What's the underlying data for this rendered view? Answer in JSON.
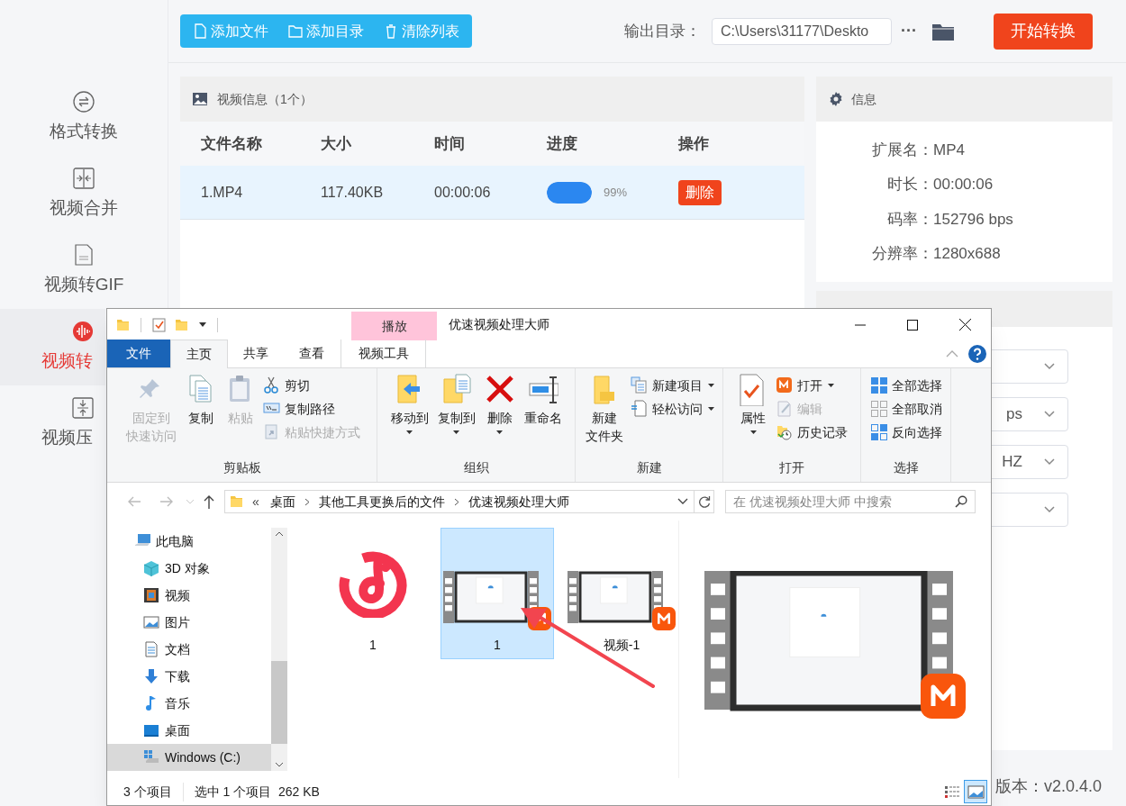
{
  "app": {
    "toolbar_buttons": [
      {
        "label": "添加文件",
        "kind": "file"
      },
      {
        "label": "添加目录",
        "kind": "folder"
      },
      {
        "label": "清除列表",
        "kind": "trash"
      }
    ],
    "output_dir": {
      "label": "输出目录：",
      "value": "C:\\Users\\31177\\Deskto",
      "more": "···"
    },
    "start_button": "开始转换",
    "sidebar": [
      {
        "label": "格式转换",
        "kind": "convert",
        "selected": false
      },
      {
        "label": "视频合并",
        "kind": "merge",
        "selected": false
      },
      {
        "label": "视频转GIF",
        "kind": "gif",
        "selected": false
      },
      {
        "label": "视频转",
        "kind": "audio",
        "selected": true
      },
      {
        "label": "视频压",
        "kind": "compress",
        "selected": false
      }
    ],
    "video_panel": {
      "title": "视频信息（1个）",
      "columns": [
        "文件名称",
        "大小",
        "时间",
        "进度",
        "操作"
      ],
      "rows": [
        {
          "name": "1.MP4",
          "size": "117.40KB",
          "time": "00:00:06",
          "level": 0.99,
          "percent": "99%",
          "action": "删除",
          "selected": true
        }
      ]
    },
    "info_panel": {
      "title": "信息",
      "fields": [
        {
          "label": "扩展名：",
          "value": "MP4"
        },
        {
          "label": "时长：",
          "value": "00:00:06"
        },
        {
          "label": "码率：",
          "value": "152796 bps"
        },
        {
          "label": "分辨率：",
          "value": "1280x688"
        }
      ]
    },
    "settings_panel": {
      "dropdowns": [
        {
          "kind": "select"
        },
        {
          "kind": "select",
          "value": "ps"
        },
        {
          "kind": "select",
          "value": "HZ"
        },
        {
          "kind": "select"
        }
      ]
    },
    "version": "版本：v2.0.4.0"
  },
  "explorer": {
    "title": "优速视频处理大师",
    "context_tab": "播放",
    "tabs": [
      {
        "label": "文件",
        "kind": "file",
        "selected": false
      },
      {
        "label": "主页",
        "kind": "tab",
        "selected": true
      },
      {
        "label": "共享",
        "kind": "tab",
        "selected": false
      },
      {
        "label": "查看",
        "kind": "tab",
        "selected": false
      },
      {
        "label": "视频工具",
        "kind": "context",
        "selected": false
      }
    ],
    "ribbon": [
      {
        "label": "剪贴板",
        "large": [
          {
            "lines": [
              "固定到",
              "快速访问"
            ],
            "kind": "pin",
            "disabled": true
          },
          {
            "label": "复制",
            "kind": "copy",
            "disabled": false
          },
          {
            "label": "粘贴",
            "kind": "paste",
            "disabled": true
          }
        ],
        "small": [
          {
            "label": "剪切",
            "kind": "cut",
            "disabled": false,
            "dropdown": false
          },
          {
            "label": "复制路径",
            "kind": "path",
            "disabled": false,
            "dropdown": false
          },
          {
            "label": "粘贴快捷方式",
            "kind": "shortcut",
            "disabled": true,
            "dropdown": false
          }
        ]
      },
      {
        "label": "组织",
        "large": [
          {
            "label": "移动到",
            "kind": "move",
            "disabled": false,
            "dropdown": true
          },
          {
            "label": "复制到",
            "kind": "copyto",
            "disabled": false,
            "dropdown": true
          },
          {
            "label": "删除",
            "kind": "delete",
            "disabled": false,
            "dropdown": true
          },
          {
            "label": "重命名",
            "kind": "rename",
            "disabled": false
          }
        ]
      },
      {
        "label": "新建",
        "large": [
          {
            "lines": [
              "新建",
              "文件夹"
            ],
            "kind": "newfolder",
            "disabled": false
          }
        ],
        "small": [
          {
            "label": "新建项目",
            "kind": "newitem",
            "disabled": false,
            "dropdown": true
          },
          {
            "label": "轻松访问",
            "kind": "easy",
            "disabled": false,
            "dropdown": true
          }
        ]
      },
      {
        "label": "打开",
        "large": [
          {
            "label": "属性",
            "kind": "props",
            "disabled": false,
            "dropdown": true
          }
        ],
        "small": [
          {
            "label": "打开",
            "kind": "open",
            "disabled": false,
            "dropdown": true
          },
          {
            "label": "编辑",
            "kind": "edit",
            "disabled": true,
            "dropdown": false
          },
          {
            "label": "历史记录",
            "kind": "history",
            "disabled": false,
            "dropdown": false
          }
        ]
      },
      {
        "label": "选择",
        "small": [
          {
            "label": "全部选择",
            "kind": "selall",
            "disabled": false,
            "dropdown": false
          },
          {
            "label": "全部取消",
            "kind": "selnone",
            "disabled": false,
            "dropdown": false
          },
          {
            "label": "反向选择",
            "kind": "invert",
            "disabled": false,
            "dropdown": false
          }
        ]
      }
    ],
    "address": {
      "overflow": "«",
      "crumbs": [
        "桌面",
        "其他工具更换后的文件",
        "优速视频处理大师"
      ],
      "search_placeholder": "在 优速视频处理大师 中搜索"
    },
    "nav": [
      {
        "label": "此电脑",
        "kind": "pc",
        "selected": false,
        "children": [
          {
            "label": "3D 对象",
            "kind": "cube",
            "selected": false
          },
          {
            "label": "视频",
            "kind": "video",
            "selected": false
          },
          {
            "label": "图片",
            "kind": "picture",
            "selected": false
          },
          {
            "label": "文档",
            "kind": "doc",
            "selected": false
          },
          {
            "label": "下载",
            "kind": "download",
            "selected": false
          },
          {
            "label": "音乐",
            "kind": "music",
            "selected": false
          },
          {
            "label": "桌面",
            "kind": "desktop",
            "selected": false
          },
          {
            "label": "Windows (C:)",
            "kind": "drive",
            "selected": true
          }
        ]
      }
    ],
    "files": [
      {
        "label": "1",
        "kind": "music",
        "selected": false
      },
      {
        "label": "1",
        "kind": "video",
        "selected": true
      },
      {
        "label": "视频-1",
        "kind": "video",
        "selected": false
      }
    ],
    "status": {
      "count": "3 个项目",
      "selection": "选中 1 个项目  262 KB"
    },
    "views": [
      {
        "kind": "details",
        "selected": false
      },
      {
        "kind": "thumbs",
        "selected": true
      }
    ]
  }
}
